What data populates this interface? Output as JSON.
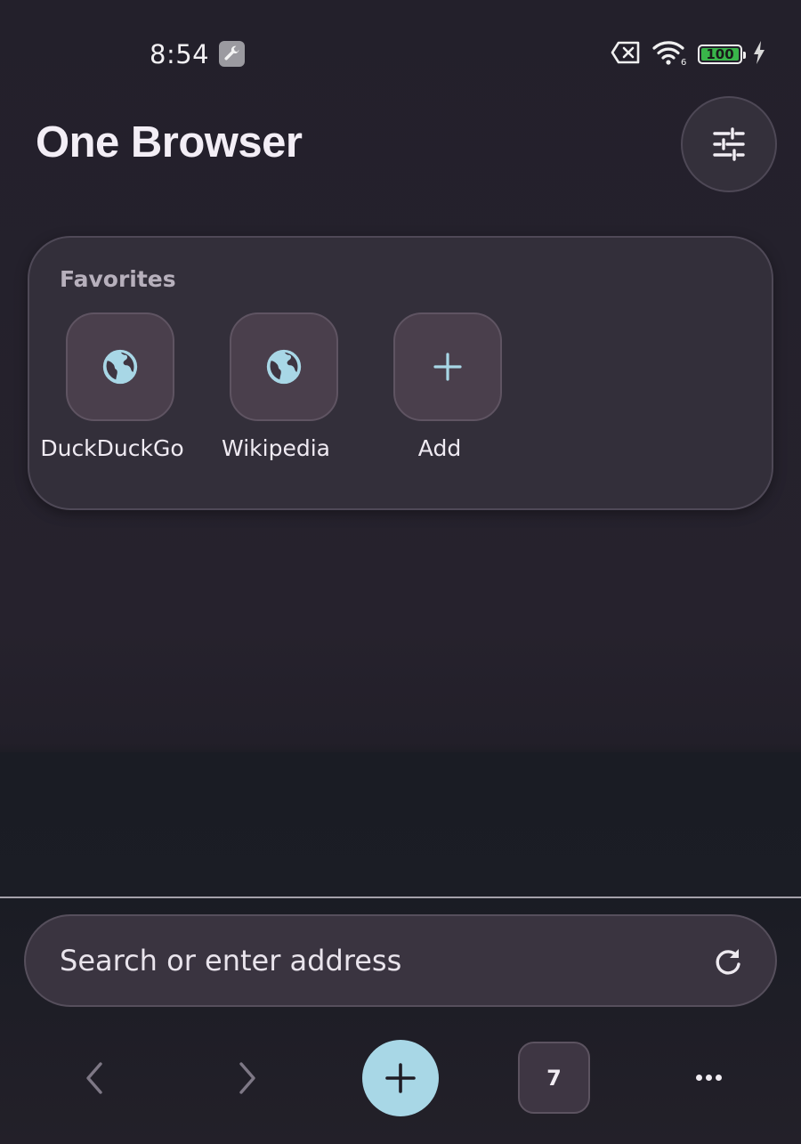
{
  "status_bar": {
    "time": "8:54",
    "battery_level": "100",
    "wifi_label": "6",
    "icons": [
      "wrench-icon",
      "sim-missing-icon",
      "wifi-icon",
      "battery-icon",
      "charging-bolt-icon"
    ]
  },
  "header": {
    "title": "One Browser",
    "settings_icon": "sliders-icon"
  },
  "favorites": {
    "heading": "Favorites",
    "items": [
      {
        "label": "DuckDuckGo",
        "icon": "globe-icon"
      },
      {
        "label": "Wikipedia",
        "icon": "globe-icon"
      },
      {
        "label": "Add",
        "icon": "plus-icon"
      }
    ]
  },
  "address_bar": {
    "placeholder": "Search or enter address",
    "value": "",
    "action_icon": "reload-icon"
  },
  "toolbar": {
    "tab_count": "7",
    "icons": [
      "back-arrow-icon",
      "forward-arrow-icon",
      "plus-icon",
      "more-dots-icon"
    ]
  },
  "colors": {
    "background": "#23202b",
    "card": "#332f3a",
    "accent": "#a8d7e6",
    "icon_blue": "#a8d7e6",
    "battery_green": "#39b54a"
  }
}
